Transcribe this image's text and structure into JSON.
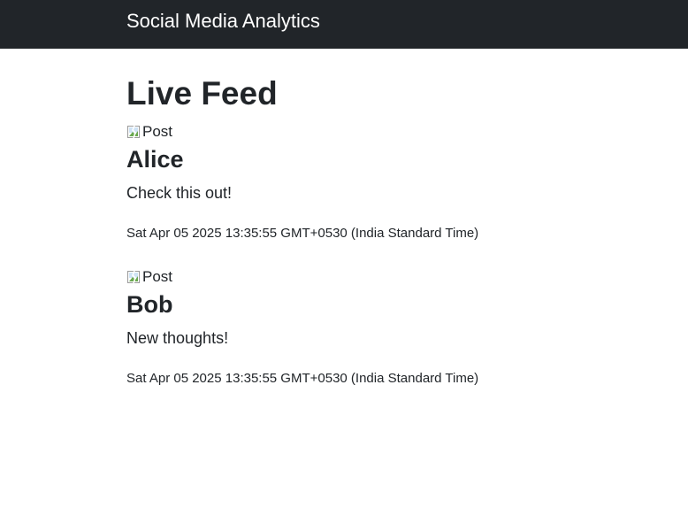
{
  "navbar": {
    "brand": "Social Media Analytics"
  },
  "main": {
    "title": "Live Feed",
    "posts": [
      {
        "image_alt": "Post",
        "author": "Alice",
        "content": "Check this out!",
        "timestamp": "Sat Apr 05 2025 13:35:55 GMT+0530 (India Standard Time)"
      },
      {
        "image_alt": "Post",
        "author": "Bob",
        "content": "New thoughts!",
        "timestamp": "Sat Apr 05 2025 13:35:55 GMT+0530 (India Standard Time)"
      }
    ]
  },
  "icons": {
    "post_image": "broken-image-icon"
  }
}
